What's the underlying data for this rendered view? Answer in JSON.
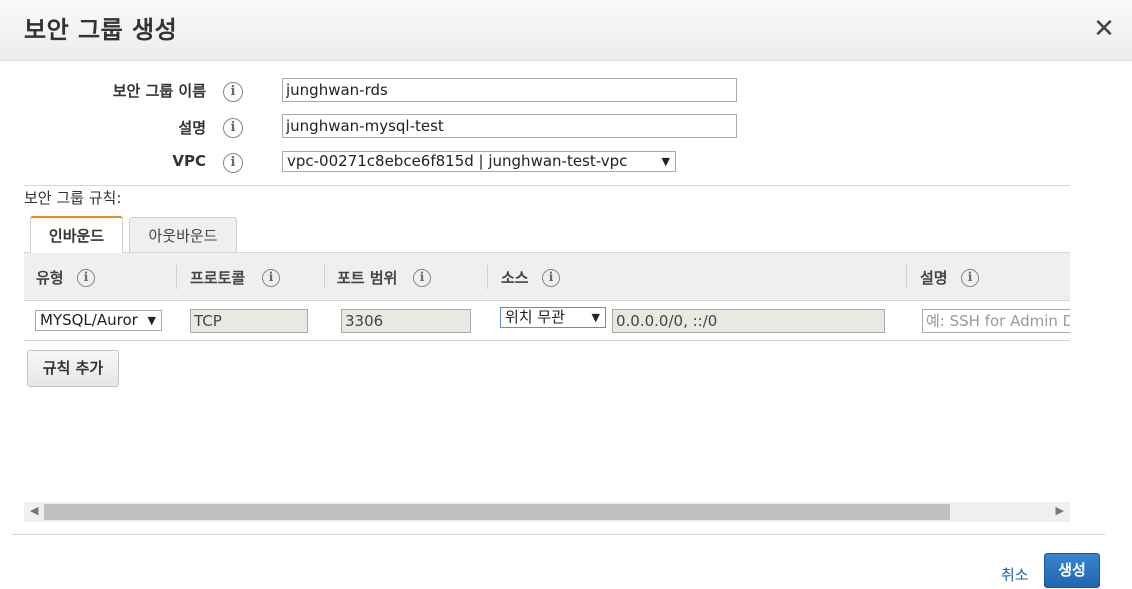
{
  "dialog": {
    "title": "보안 그룹 생성",
    "close_icon": "close-icon"
  },
  "form": {
    "name_label": "보안 그룹 이름",
    "name_value": "junghwan-rds",
    "desc_label": "설명",
    "desc_value": "junghwan-mysql-test",
    "vpc_label": "VPC",
    "vpc_value": "vpc-00271c8ebce6f815d | junghwan-test-vpc"
  },
  "rules": {
    "label": "보안 그룹 규칙:",
    "tabs": [
      {
        "label": "인바운드",
        "active": true
      },
      {
        "label": "아웃바운드",
        "active": false
      }
    ],
    "columns": [
      "유형",
      "프로토콜",
      "포트 범위",
      "소스",
      "설명"
    ],
    "row": {
      "type": "MYSQL/Auror",
      "protocol": "TCP",
      "port": "3306",
      "source_select": "위치 무관",
      "source_value": "0.0.0.0/0, ::/0",
      "desc_placeholder": "예: SSH for Admin D"
    },
    "add_rule_label": "규칙 추가"
  },
  "footer": {
    "cancel_label": "취소",
    "create_label": "생성"
  },
  "colors": {
    "active_tab_accent": "#e48f1a",
    "primary_button": "#1f64ad",
    "link": "#1a66b0"
  }
}
